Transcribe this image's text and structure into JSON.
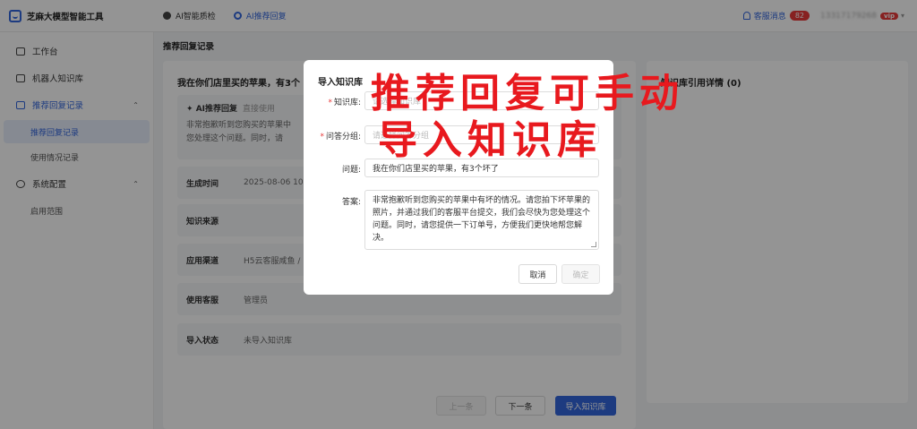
{
  "app": {
    "title": "芝麻大模型智能工具"
  },
  "topnav": [
    {
      "label": "AI智能质检",
      "icon": "chart-icon"
    },
    {
      "label": "AI推荐回复",
      "icon": "reply-icon"
    }
  ],
  "header": {
    "messages_label": "客服消息",
    "messages_count": "82",
    "user": "13317179268",
    "vip": "vip"
  },
  "sidebar": {
    "items": [
      {
        "label": "工作台",
        "icon": "monitor-icon"
      },
      {
        "label": "机器人知识库",
        "icon": "book-icon"
      },
      {
        "label": "推荐回复记录",
        "icon": "record-icon",
        "arrow": "⌃"
      },
      {
        "label": "系统配置",
        "icon": "gear-icon",
        "arrow": "⌃"
      }
    ],
    "sub_recommend": [
      "推荐回复记录",
      "使用情况记录"
    ],
    "sub_system": [
      "启用范围"
    ]
  },
  "breadcrumb": "推荐回复记录",
  "detail": {
    "question_title": "我在你们店里买的苹果，有3个",
    "ai_label": "AI推荐回复",
    "ai_sub": "直接使用",
    "ai_text_line1": "非常抱歉听到您购买的苹果中",
    "ai_text_line2": "您处理这个问题。同时，请",
    "rows": [
      {
        "label": "生成时间",
        "value": "2025-08-06 10:4"
      },
      {
        "label": "知识来源",
        "value": ""
      },
      {
        "label": "应用渠道",
        "value": "H5云客服咸鱼 /"
      },
      {
        "label": "使用客服",
        "value": "管理员"
      },
      {
        "label": "导入状态",
        "value": "未导入知识库"
      }
    ],
    "buttons": {
      "prev": "上一条",
      "next": "下一条",
      "import": "导入知识库"
    }
  },
  "kb_panel": {
    "title": "知识库引用详情 (0)"
  },
  "modal": {
    "title": "导入知识库",
    "fields": {
      "kb_label": "知识库:",
      "kb_placeholder": "请选择知识库",
      "group_label": "问答分组:",
      "group_placeholder": "请选择问答分组",
      "question_label": "问题:",
      "question_value": "我在你们店里买的苹果，有3个坏了",
      "answer_label": "答案:",
      "answer_value": "非常抱歉听到您购买的苹果中有坏的情况。请您拍下坏苹果的照片，并通过我们的客服平台提交，我们会尽快为您处理这个问题。同时，请您提供一下订单号，方便我们更快地帮您解决。"
    },
    "cancel": "取消",
    "confirm": "确定"
  },
  "annotation": {
    "line1": "推荐回复可手动",
    "line2": "导入知识库"
  }
}
